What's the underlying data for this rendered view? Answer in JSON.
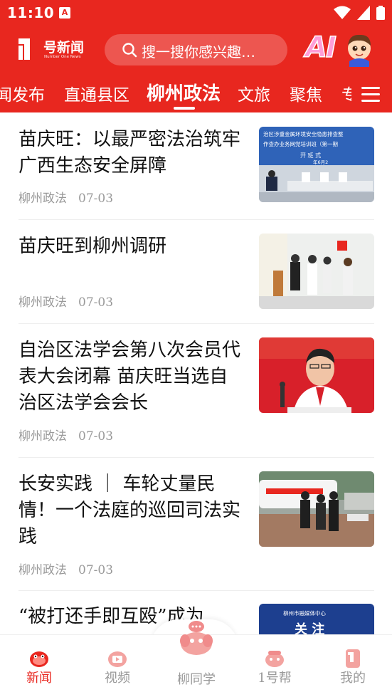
{
  "status_bar": {
    "time": "11:10",
    "app_badge": "A"
  },
  "header": {
    "logo_text": "号新闻",
    "logo_sub": "Number One News",
    "search_placeholder": "搜一搜你感兴趣…",
    "ai_label": "AI"
  },
  "tabs": [
    {
      "label": "闻发布"
    },
    {
      "label": "直通县区"
    },
    {
      "label": "柳州政法",
      "active": true
    },
    {
      "label": "文旅"
    },
    {
      "label": "聚焦"
    },
    {
      "label": "专"
    }
  ],
  "news": [
    {
      "title": "苗庆旺：以最严密法治筑牢广西生态安全屏障",
      "source": "柳州政法",
      "date": "07-03"
    },
    {
      "title": "苗庆旺到柳州调研",
      "source": "柳州政法",
      "date": "07-03"
    },
    {
      "title": "自治区法学会第八次会员代表大会闭幕 苗庆旺当选自治区法学会会长",
      "source": "柳州政法",
      "date": "07-03"
    },
    {
      "title": "长安实践 ｜ 车轮丈量民情！一个法庭的巡回司法实践",
      "source": "柳州政法",
      "date": "07-03"
    },
    {
      "title": "“被打还手即互殴”成为",
      "source": "",
      "date": ""
    }
  ],
  "thumb_texts": {
    "banner_1": "治区涉重金属环境安全隐患排查整",
    "banner_2": "作查办业务网党培训班（第一期",
    "banner_3": "开 班 式",
    "banner_4": "年6月2",
    "media_center": "柳州市融媒体中心",
    "banner_5": "关 注"
  },
  "bottom_nav": [
    {
      "label": "新闻",
      "active": true
    },
    {
      "label": "视频"
    },
    {
      "label": "柳同学"
    },
    {
      "label": "1号帮"
    },
    {
      "label": "我的"
    }
  ],
  "colors": {
    "brand_red": "#e8271f",
    "meta_gray": "#999999"
  }
}
